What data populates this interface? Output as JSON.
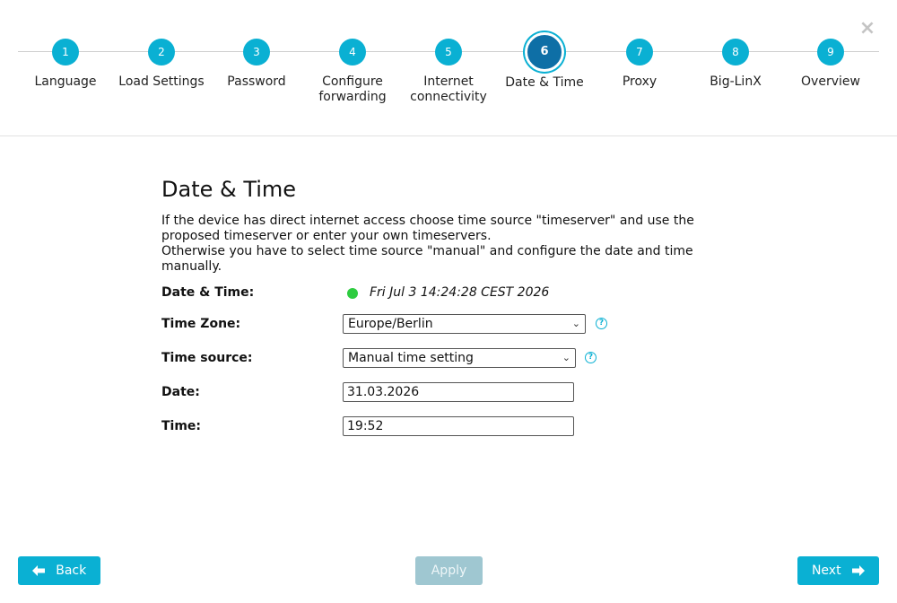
{
  "header": {
    "close_icon": "×"
  },
  "steps": [
    {
      "number": "1",
      "label": "Language"
    },
    {
      "number": "2",
      "label": "Load Settings"
    },
    {
      "number": "3",
      "label": "Password"
    },
    {
      "number": "4",
      "label": "Configure forwarding"
    },
    {
      "number": "5",
      "label": "Internet connectivity"
    },
    {
      "number": "6",
      "label": "Date & Time",
      "active": true
    },
    {
      "number": "7",
      "label": "Proxy"
    },
    {
      "number": "8",
      "label": "Big-LinX"
    },
    {
      "number": "9",
      "label": "Overview"
    }
  ],
  "main": {
    "title": "Date & Time",
    "description_line1": "If the device has direct internet access choose time source \"timeserver\" and use the proposed timeserver or enter your own timeservers.",
    "description_line2": "Otherwise you have to select time source \"manual\" and configure the date and time manually."
  },
  "form": {
    "datetime_label": "Date & Time:",
    "datetime_value": "Fri Jul 3 14:24:28 CEST 2026",
    "timezone_label": "Time Zone:",
    "timezone_value": "Europe/Berlin",
    "timesource_label": "Time source:",
    "timesource_value": "Manual time setting",
    "date_label": "Date:",
    "date_value": "31.03.2026",
    "time_label": "Time:",
    "time_value": "19:52",
    "help_glyph": "?",
    "dropdown_glyph": "⌄"
  },
  "footer": {
    "back_label": "Back",
    "apply_label": "Apply",
    "next_label": "Next"
  },
  "colors": {
    "accent": "#0ab0d3",
    "active_step": "#0e6fa6",
    "status_ok": "#2ecc40",
    "apply_disabled": "#9fc7d1"
  }
}
